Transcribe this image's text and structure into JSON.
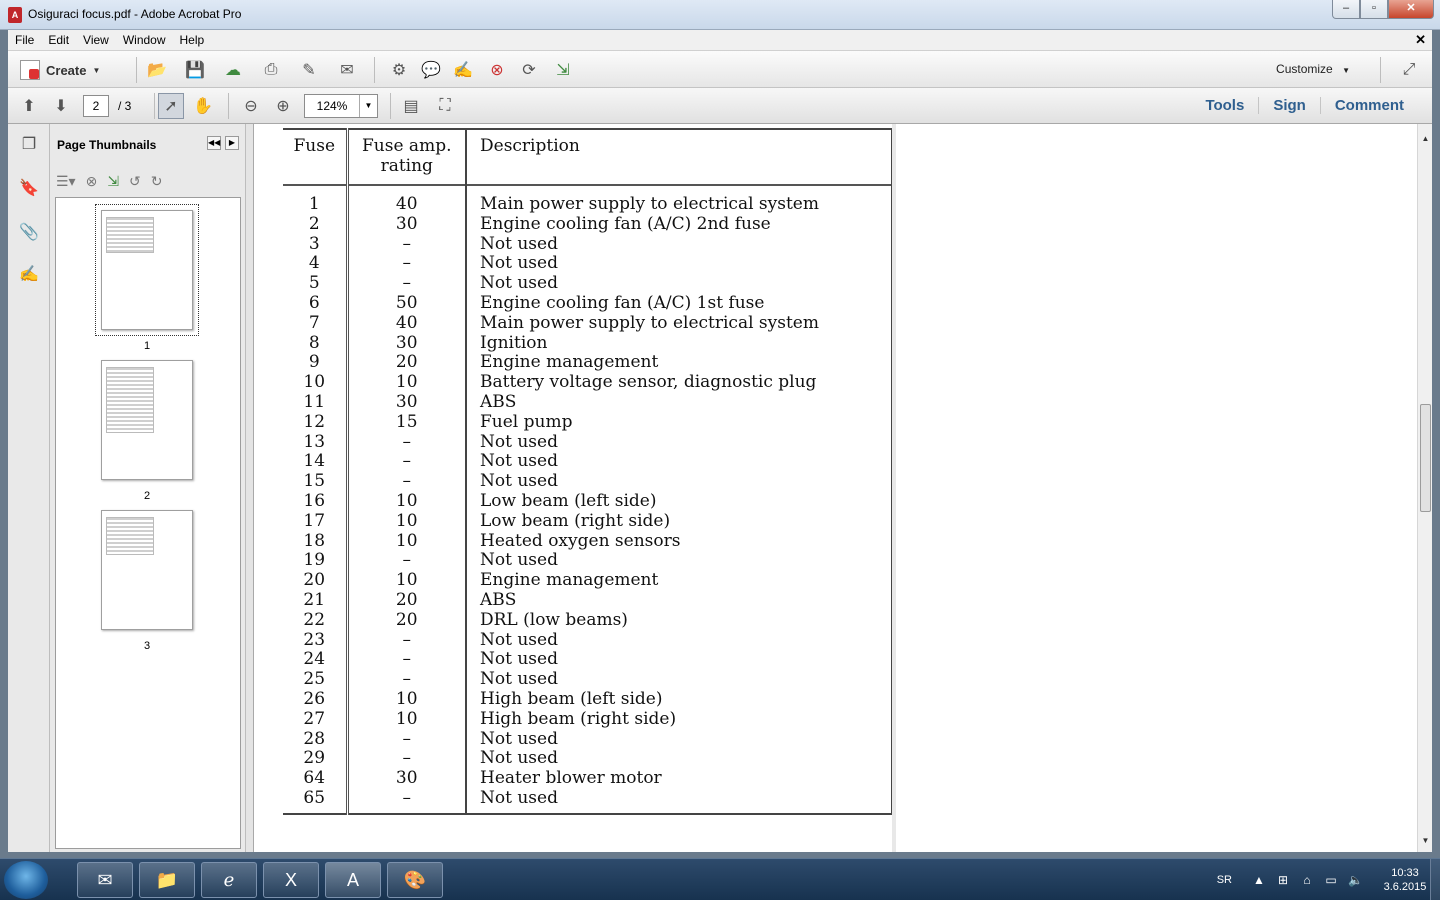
{
  "window": {
    "title": "Osiguraci focus.pdf - Adobe Acrobat Pro"
  },
  "menu": [
    "File",
    "Edit",
    "View",
    "Window",
    "Help"
  ],
  "toolbar": {
    "create_label": "Create",
    "customize_label": "Customize"
  },
  "nav": {
    "current_page": "2",
    "total_pages": "/ 3",
    "zoom": "124%"
  },
  "right_links": [
    "Tools",
    "Sign",
    "Comment"
  ],
  "thumbnails": {
    "title": "Page Thumbnails",
    "pages": [
      "1",
      "2",
      "3"
    ]
  },
  "fuse_table": {
    "headers": [
      "Fuse",
      "Fuse amp. rating",
      "Description"
    ],
    "rows": [
      [
        "1",
        "40",
        "Main power supply to electrical system"
      ],
      [
        "2",
        "30",
        "Engine cooling fan (A/C) 2nd fuse"
      ],
      [
        "3",
        "–",
        "Not used"
      ],
      [
        "4",
        "–",
        "Not used"
      ],
      [
        "5",
        "–",
        "Not used"
      ],
      [
        "6",
        "50",
        "Engine cooling fan (A/C) 1st fuse"
      ],
      [
        "7",
        "40",
        "Main power supply to electrical system"
      ],
      [
        "8",
        "30",
        "Ignition"
      ],
      [
        "9",
        "20",
        "Engine management"
      ],
      [
        "10",
        "10",
        "Battery voltage sensor, diagnostic plug"
      ],
      [
        "11",
        "30",
        "ABS"
      ],
      [
        "12",
        "15",
        "Fuel pump"
      ],
      [
        "13",
        "–",
        "Not used"
      ],
      [
        "14",
        "–",
        "Not used"
      ],
      [
        "15",
        "–",
        "Not used"
      ],
      [
        "16",
        "10",
        "Low beam (left side)"
      ],
      [
        "17",
        "10",
        "Low beam (right side)"
      ],
      [
        "18",
        "10",
        "Heated oxygen sensors"
      ],
      [
        "19",
        "–",
        "Not used"
      ],
      [
        "20",
        "10",
        "Engine management"
      ],
      [
        "21",
        "20",
        "ABS"
      ],
      [
        "22",
        "20",
        "DRL (low beams)"
      ],
      [
        "23",
        "–",
        "Not used"
      ],
      [
        "24",
        "–",
        "Not used"
      ],
      [
        "25",
        "–",
        "Not used"
      ],
      [
        "26",
        "10",
        "High beam (left side)"
      ],
      [
        "27",
        "10",
        "High beam (right side)"
      ],
      [
        "28",
        "–",
        "Not used"
      ],
      [
        "29",
        "–",
        "Not used"
      ],
      [
        "64",
        "30",
        "Heater blower motor"
      ],
      [
        "65",
        "–",
        "Not used"
      ]
    ]
  },
  "taskbar": {
    "lang": "SR",
    "time": "10:33",
    "date": "3.6.2015"
  }
}
